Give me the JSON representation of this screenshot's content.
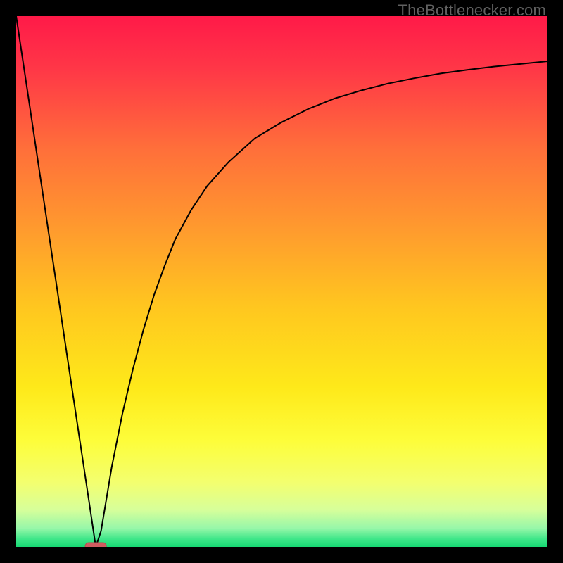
{
  "watermark": "TheBottlenecker.com",
  "colors": {
    "frame": "#000000",
    "watermark": "#616161",
    "curve": "#000000",
    "marker_fill": "#cf5b60",
    "marker_stroke": "#b94a50",
    "gradient_stops": [
      {
        "offset": 0.0,
        "color": "#ff1a48"
      },
      {
        "offset": 0.1,
        "color": "#ff3747"
      },
      {
        "offset": 0.25,
        "color": "#ff6f3a"
      },
      {
        "offset": 0.4,
        "color": "#ff9a2e"
      },
      {
        "offset": 0.55,
        "color": "#ffc71f"
      },
      {
        "offset": 0.7,
        "color": "#fee91a"
      },
      {
        "offset": 0.8,
        "color": "#fdfd3a"
      },
      {
        "offset": 0.88,
        "color": "#f3ff70"
      },
      {
        "offset": 0.93,
        "color": "#d7ff9a"
      },
      {
        "offset": 0.965,
        "color": "#97f7a9"
      },
      {
        "offset": 0.985,
        "color": "#3fe789"
      },
      {
        "offset": 1.0,
        "color": "#17d873"
      }
    ]
  },
  "chart_data": {
    "type": "line",
    "title": "",
    "xlabel": "",
    "ylabel": "",
    "xlim": [
      0,
      100
    ],
    "ylim": [
      0,
      100
    ],
    "x": [
      0,
      2,
      4,
      6,
      8,
      10,
      12,
      14,
      15,
      16,
      17,
      18,
      20,
      22,
      24,
      26,
      28,
      30,
      33,
      36,
      40,
      45,
      50,
      55,
      60,
      65,
      70,
      75,
      80,
      85,
      90,
      95,
      100
    ],
    "values": [
      100,
      86.7,
      73.3,
      60.0,
      46.7,
      33.3,
      20.0,
      6.7,
      0.0,
      3.0,
      9.0,
      15.0,
      25.0,
      33.5,
      41.0,
      47.5,
      53.0,
      58.0,
      63.5,
      68.0,
      72.5,
      77.0,
      80.0,
      82.5,
      84.5,
      86.0,
      87.3,
      88.3,
      89.2,
      89.9,
      90.5,
      91.0,
      91.5
    ],
    "marker": {
      "x": 15,
      "y": 0
    },
    "annotations": []
  }
}
